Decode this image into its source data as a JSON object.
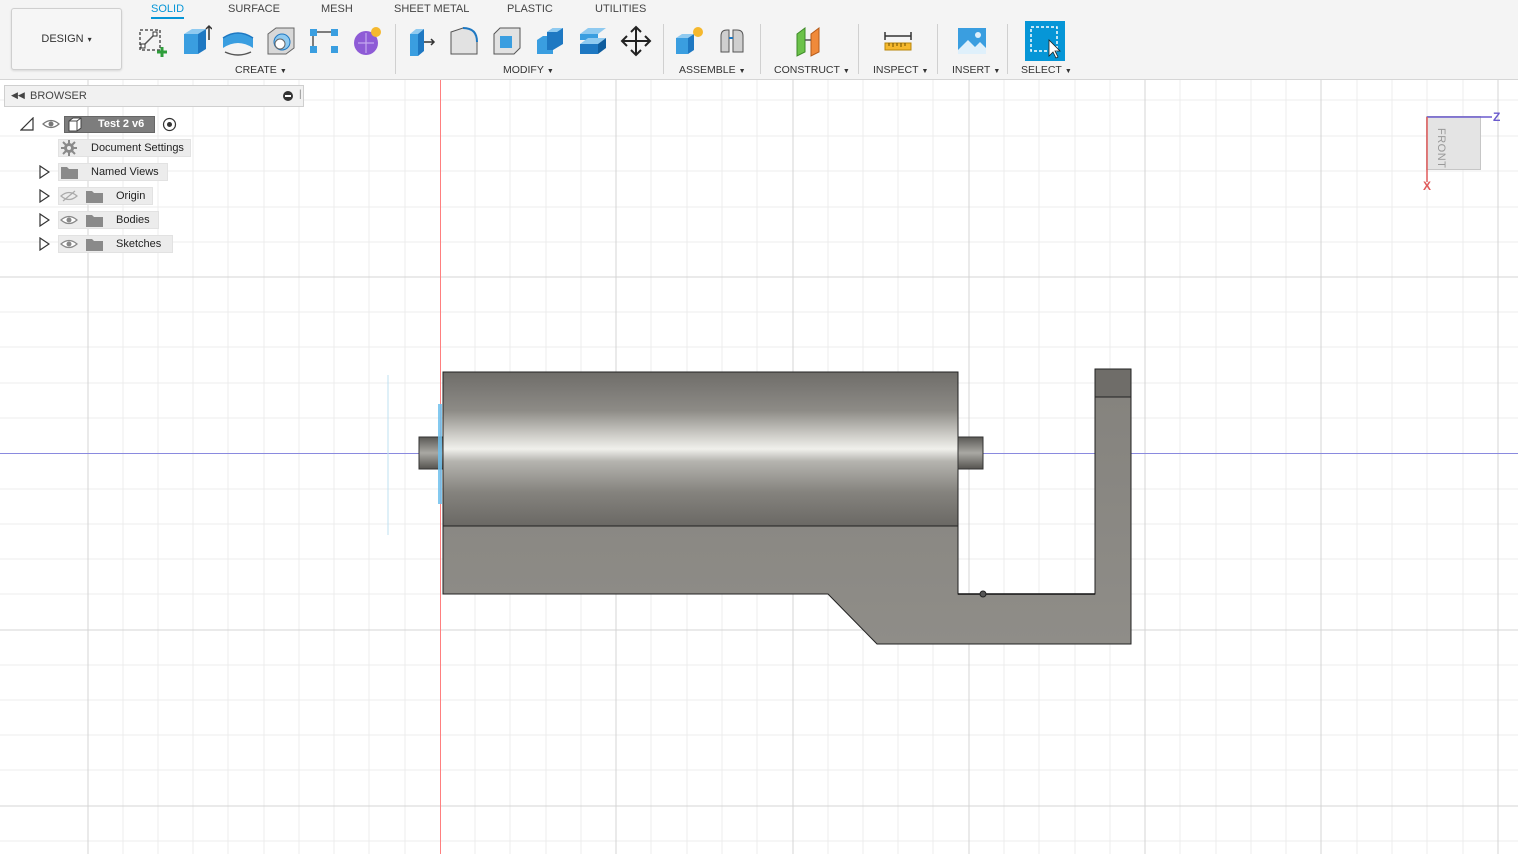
{
  "workspace": {
    "label": "DESIGN",
    "caret": "▾"
  },
  "tabs": [
    {
      "label": "SOLID",
      "active": true
    },
    {
      "label": "SURFACE"
    },
    {
      "label": "MESH"
    },
    {
      "label": "SHEET METAL"
    },
    {
      "label": "PLASTIC"
    },
    {
      "label": "UTILITIES"
    }
  ],
  "groups": {
    "create": "CREATE",
    "modify": "MODIFY",
    "assemble": "ASSEMBLE",
    "construct": "CONSTRUCT",
    "inspect": "INSPECT",
    "insert": "INSERT",
    "select": "SELECT"
  },
  "tools": {
    "create": [
      "create-sketch-icon",
      "extrude-icon",
      "revolve-icon",
      "hole-icon",
      "pattern-icon",
      "create-form-icon"
    ],
    "modify": [
      "press-pull-icon",
      "fillet-icon",
      "shell-icon",
      "combine-icon",
      "offset-face-icon",
      "move-icon"
    ],
    "assemble": [
      "new-component-icon",
      "joint-icon"
    ],
    "construct": [
      "offset-plane-icon"
    ],
    "inspect": [
      "measure-icon"
    ],
    "insert": [
      "insert-image-icon"
    ],
    "select": [
      "window-select-icon"
    ]
  },
  "browser": {
    "title": "BROWSER",
    "root": "Test 2 v6",
    "items": [
      {
        "label": "Document Settings",
        "icon": "gear-icon",
        "visibility": "none"
      },
      {
        "label": "Named Views",
        "icon": "folder-icon",
        "visibility": "none"
      },
      {
        "label": "Origin",
        "icon": "folder-icon",
        "visibility": "hidden"
      },
      {
        "label": "Bodies",
        "icon": "folder-icon",
        "visibility": "visible"
      },
      {
        "label": "Sketches",
        "icon": "folder-icon",
        "visibility": "visible"
      }
    ]
  },
  "viewcube": {
    "face": "FRONT",
    "axis_z": "Z",
    "axis_x": "X"
  },
  "colors": {
    "accent": "#0696d7",
    "model_gray": "#8c8a84",
    "model_dark": "#6e6c68",
    "axis_red": "#ff6b6b",
    "axis_blue": "#7a7adb",
    "grid": "#e1e1e1"
  }
}
